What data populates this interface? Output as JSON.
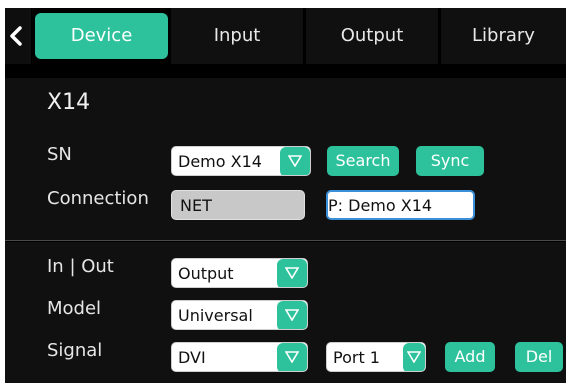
{
  "tabs": [
    {
      "label": "Device",
      "active": true
    },
    {
      "label": "Input",
      "active": false
    },
    {
      "label": "Output",
      "active": false
    },
    {
      "label": "Library",
      "active": false
    }
  ],
  "device": {
    "title": "X14",
    "sn_label": "SN",
    "sn_value": "Demo X14",
    "search_label": "Search",
    "sync_label": "Sync",
    "connection_label": "Connection",
    "connection_type": "NET",
    "connection_value": "P: Demo X14"
  },
  "io": {
    "inout_label": "In | Out",
    "inout_value": "Output",
    "model_label": "Model",
    "model_value": "Universal",
    "signal_label": "Signal",
    "signal_value": "DVI",
    "port_value": "Port  1",
    "add_label": "Add",
    "del_label": "Del"
  },
  "icons": {
    "back": "chevron-left-icon",
    "dropdown": "triangle-down-icon"
  },
  "colors": {
    "accent": "#2dc29c",
    "background": "#000000",
    "panel": "#101010",
    "focus_border": "#3b8fd8"
  }
}
